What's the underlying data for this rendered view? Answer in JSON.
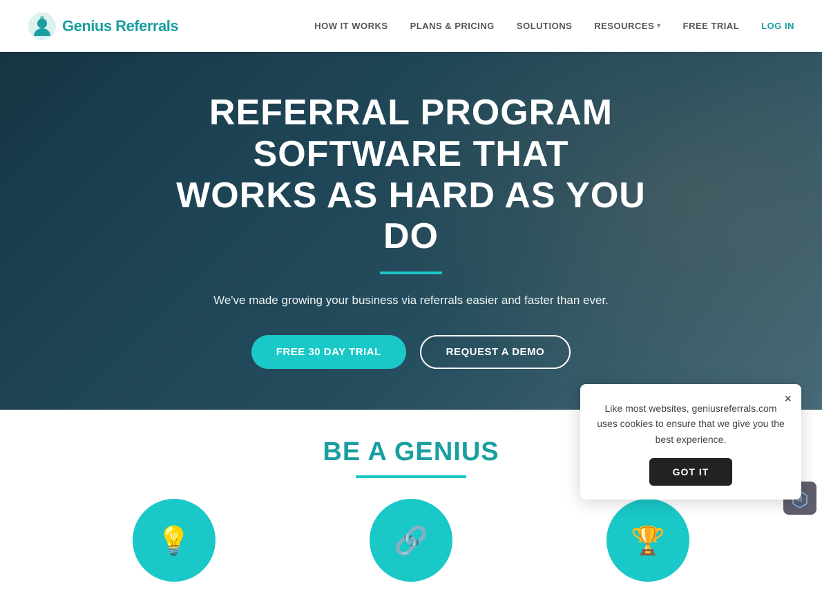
{
  "navbar": {
    "logo_text": "Genius Referrals",
    "nav_items": [
      {
        "id": "how-it-works",
        "label": "HOW IT WORKS",
        "has_dropdown": false
      },
      {
        "id": "plans-pricing",
        "label": "PLANS & PRICING",
        "has_dropdown": false
      },
      {
        "id": "solutions",
        "label": "SOLUTIONS",
        "has_dropdown": false
      },
      {
        "id": "resources",
        "label": "RESOURCES",
        "has_dropdown": true
      },
      {
        "id": "free-trial",
        "label": "FREE TRIAL",
        "has_dropdown": false
      },
      {
        "id": "login",
        "label": "LOG IN",
        "has_dropdown": false
      }
    ]
  },
  "hero": {
    "title_line1": "REFERRAL PROGRAM SOFTWARE THAT",
    "title_line2": "WORKS AS HARD AS YOU DO",
    "subtitle": "We've made growing your business via referrals easier and faster than ever.",
    "btn_trial": "FREE 30 DAY TRIAL",
    "btn_demo": "REQUEST A DEMO"
  },
  "be_genius": {
    "title": "BE A GENIUS",
    "icons": [
      "💡",
      "🔗",
      "🏆"
    ]
  },
  "cookie": {
    "message": "Like most websites, geniusreferrals.com uses cookies to ensure that we give you the best experience.",
    "btn_label": "GOT IT",
    "close_label": "×"
  },
  "colors": {
    "teal": "#1ac8c8",
    "dark_teal": "#1a9fa0",
    "dark": "#1a3a4a"
  }
}
